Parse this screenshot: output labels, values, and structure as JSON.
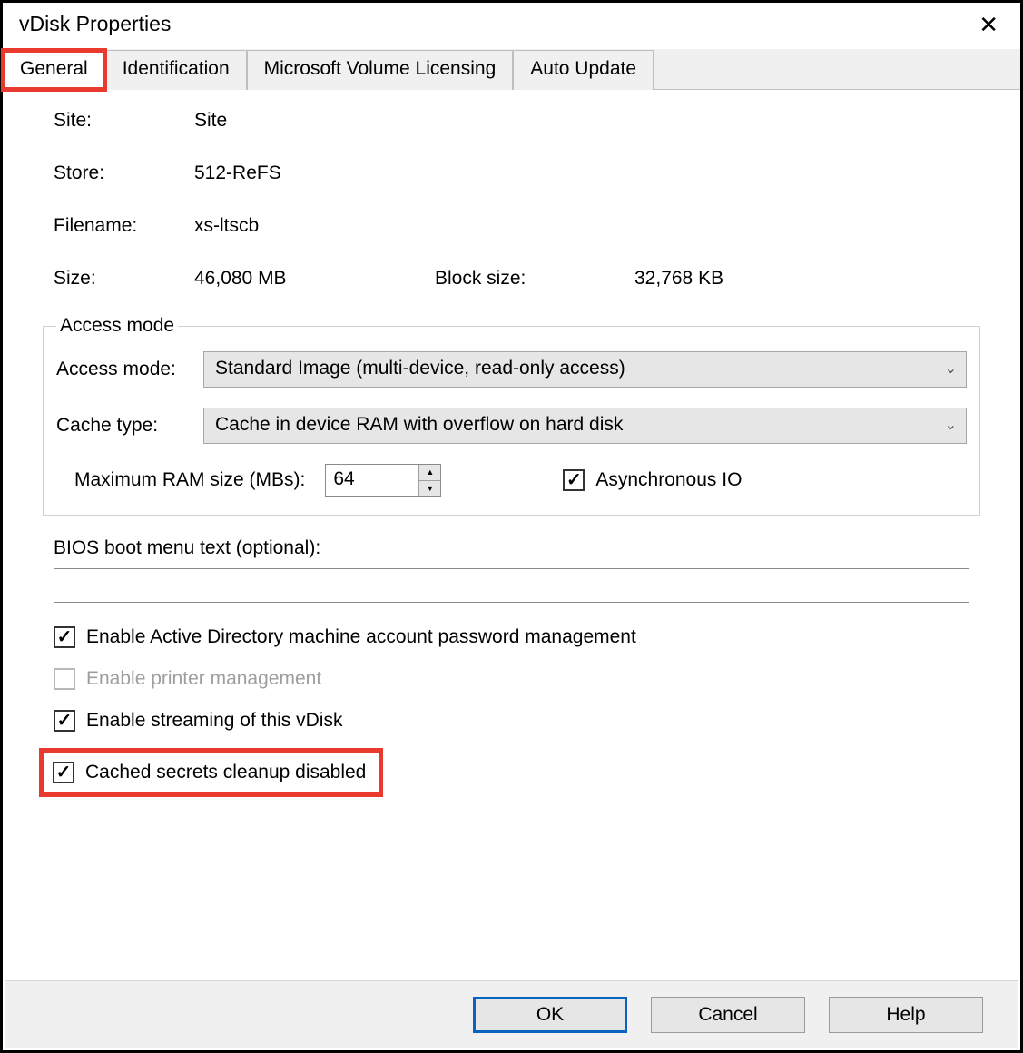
{
  "window": {
    "title": "vDisk Properties"
  },
  "tabs": [
    "General",
    "Identification",
    "Microsoft Volume Licensing",
    "Auto Update"
  ],
  "fields": {
    "site_label": "Site:",
    "site_value": "Site",
    "store_label": "Store:",
    "store_value": "512-ReFS",
    "filename_label": "Filename:",
    "filename_value": "xs-ltscb",
    "size_label": "Size:",
    "size_value": "46,080 MB",
    "blocksize_label": "Block size:",
    "blocksize_value": "32,768 KB"
  },
  "access_mode": {
    "legend": "Access mode",
    "mode_label": "Access mode:",
    "mode_value": "Standard Image (multi-device, read-only access)",
    "cache_label": "Cache type:",
    "cache_value": "Cache in device RAM with overflow on hard disk",
    "ram_label": "Maximum RAM size (MBs):",
    "ram_value": "64",
    "async_label": "Asynchronous IO"
  },
  "bios": {
    "label": "BIOS boot menu text (optional):",
    "value": ""
  },
  "checkboxes": {
    "ad_pwd": "Enable Active Directory machine account password management",
    "printer": "Enable printer management",
    "streaming": "Enable streaming of this vDisk",
    "cached_secrets": "Cached secrets cleanup disabled"
  },
  "buttons": {
    "ok": "OK",
    "cancel": "Cancel",
    "help": "Help"
  }
}
